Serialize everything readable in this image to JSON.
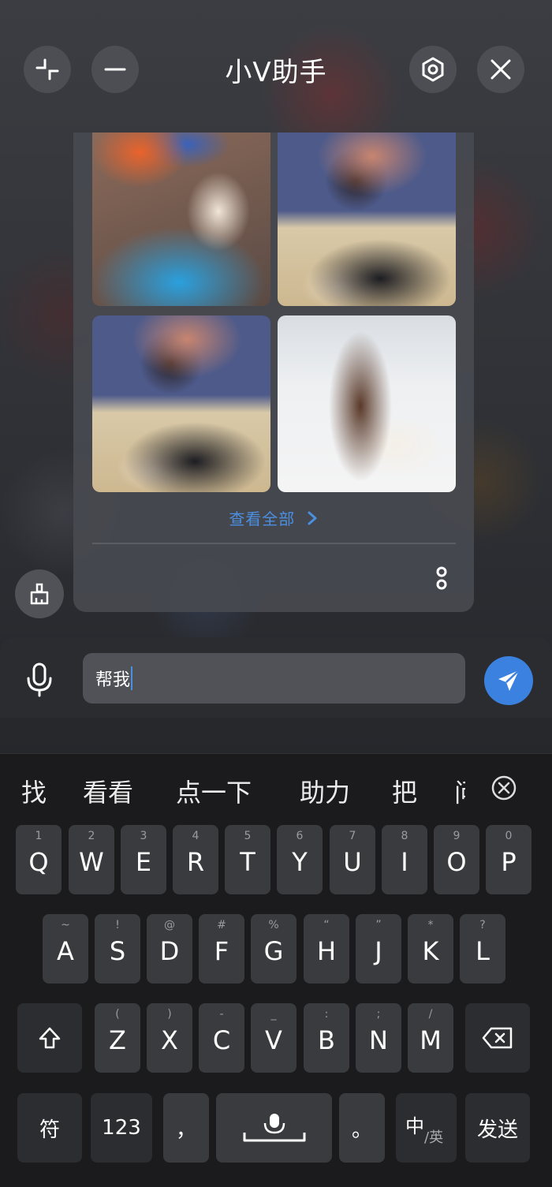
{
  "header": {
    "title": "小V助手",
    "buttons": [
      "collapse-icon",
      "minimize-icon",
      "settings-icon",
      "close-icon"
    ]
  },
  "card": {
    "view_all_label": "查看全部",
    "images": [
      "woman-with-puppy-photo",
      "couple-with-dog-video",
      "couple-with-dog-video",
      "man-with-husky-snow-photo"
    ]
  },
  "input": {
    "value": "帮我"
  },
  "keyboard": {
    "candidates": [
      "找",
      "看看",
      "点一下",
      "助力",
      "把",
      "问"
    ],
    "row1": [
      {
        "sub": "1",
        "main": "Q"
      },
      {
        "sub": "2",
        "main": "W"
      },
      {
        "sub": "3",
        "main": "E"
      },
      {
        "sub": "4",
        "main": "R"
      },
      {
        "sub": "5",
        "main": "T"
      },
      {
        "sub": "6",
        "main": "Y"
      },
      {
        "sub": "7",
        "main": "U"
      },
      {
        "sub": "8",
        "main": "I"
      },
      {
        "sub": "9",
        "main": "O"
      },
      {
        "sub": "0",
        "main": "P"
      }
    ],
    "row2": [
      {
        "sub": "~",
        "main": "A"
      },
      {
        "sub": "!",
        "main": "S"
      },
      {
        "sub": "@",
        "main": "D"
      },
      {
        "sub": "#",
        "main": "F"
      },
      {
        "sub": "%",
        "main": "G"
      },
      {
        "sub": "“",
        "main": "H"
      },
      {
        "sub": "”",
        "main": "J"
      },
      {
        "sub": "*",
        "main": "K"
      },
      {
        "sub": "?",
        "main": "L"
      }
    ],
    "row3": [
      {
        "sub": "(",
        "main": "Z"
      },
      {
        "sub": ")",
        "main": "X"
      },
      {
        "sub": "-",
        "main": "C"
      },
      {
        "sub": "_",
        "main": "V"
      },
      {
        "sub": ":",
        "main": "B"
      },
      {
        "sub": ";",
        "main": "N"
      },
      {
        "sub": "/",
        "main": "M"
      }
    ],
    "symbols_label": "符",
    "numbers_label": "123",
    "comma_label": "，",
    "period_label": "。",
    "lang_main": "中",
    "lang_sub": "/英",
    "send_label": "发送"
  },
  "colors": {
    "accent": "#3b82e0",
    "link": "#4a8fe0",
    "key_bg": "#3a3b3e",
    "keyboard_bg": "#1b1b1d"
  }
}
